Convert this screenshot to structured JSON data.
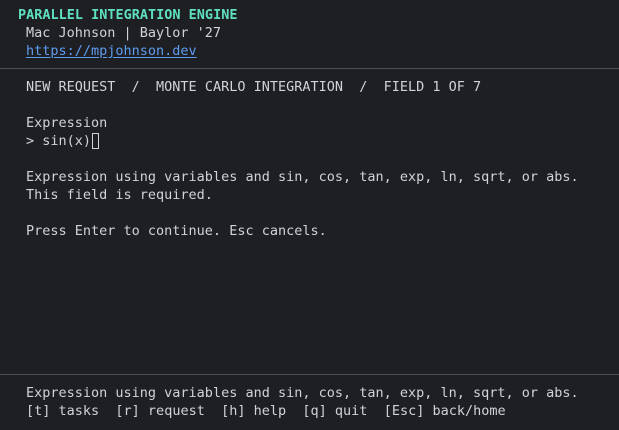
{
  "header": {
    "app_title": "PARALLEL INTEGRATION ENGINE",
    "author_line": "Mac Johnson | Baylor '27",
    "link": "https://mpjohnson.dev"
  },
  "breadcrumb": {
    "step1": "NEW REQUEST",
    "separator": "  /  ",
    "step2": "MONTE CARLO INTEGRATION",
    "step3": "FIELD 1 OF 7"
  },
  "form": {
    "field_label": "Expression",
    "prompt_symbol": "> ",
    "value": "sin(x)",
    "help_text": "Expression using variables and sin, cos, tan, exp, ln, sqrt, or abs.",
    "required_text": "This field is required.",
    "instructions": "Press Enter to continue. Esc cancels."
  },
  "footer": {
    "help_text": "Expression using variables and sin, cos, tan, exp, ln, sqrt, or abs.",
    "keys": [
      {
        "label": "[t] tasks"
      },
      {
        "label": "[r] request"
      },
      {
        "label": "[h] help"
      },
      {
        "label": "[q] quit"
      },
      {
        "label": "[Esc] back/home"
      }
    ]
  },
  "colors": {
    "background": "#1e1f23",
    "title_accent": "#5ee0c0",
    "link": "#5e9cf0",
    "text": "#cfd3da"
  }
}
